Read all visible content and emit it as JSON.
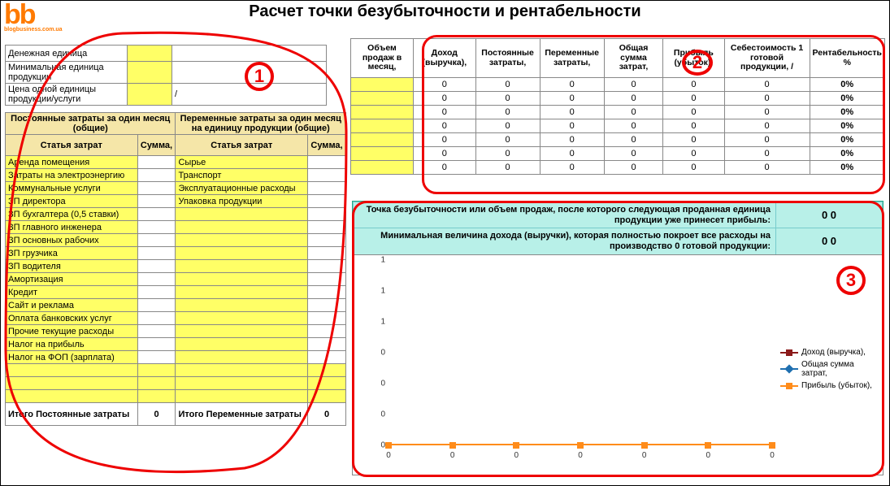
{
  "title": "Расчет точки безубыточности и рентабельности",
  "logo": {
    "bb": "bb",
    "sub": "blogbusiness.com.ua"
  },
  "params": [
    {
      "label": "Денежная единица",
      "unit": ""
    },
    {
      "label": "Минимальная единица продукции",
      "unit": ""
    },
    {
      "label": "Цена одной единицы продукции/услуги",
      "unit": "/"
    }
  ],
  "fixed_header": "Постоянные затраты за один месяц (общие)",
  "var_header": "Переменные затраты за один месяц на единицу продукции (общие)",
  "col_item": "Статья затрат",
  "col_sum": "Сумма,",
  "fixed_items": [
    "Аренда помещения",
    "Затраты на электроэнергию",
    "Коммунальные услуги",
    "ЗП директора",
    "ЗП бухгалтера (0,5 ставки)",
    "ЗП главного инженера",
    "ЗП основных рабочих",
    "ЗП грузчика",
    "ЗП водителя",
    "Амортизация",
    "Кредит",
    "Сайт и реклама",
    "Оплата банковских услуг",
    "Прочие текущие расходы",
    "Налог на прибыль",
    "Налог на ФОП (зарплата)"
  ],
  "var_items": [
    "Сырье",
    "Транспорт",
    "Эксплуатационные расходы",
    "Упаковка продукции"
  ],
  "fixed_total_label": "Итого Постоянные затраты",
  "var_total_label": "Итого Переменные затраты",
  "fixed_total": "0",
  "var_total": "0",
  "rtop_headers": [
    "Объем продаж в месяц,",
    "Доход (выручка),",
    "Постоянные затраты,",
    "Переменные затраты,",
    "Общая сумма затрат,",
    "Прибыль (убыток),",
    "Себестоимость 1 готовой продукции, /",
    "Рентабельность %"
  ],
  "rtop_rows": [
    [
      "",
      "0",
      "0",
      "0",
      "0",
      "0",
      "0",
      "0%"
    ],
    [
      "",
      "0",
      "0",
      "0",
      "0",
      "0",
      "0",
      "0%"
    ],
    [
      "",
      "0",
      "0",
      "0",
      "0",
      "0",
      "0",
      "0%"
    ],
    [
      "",
      "0",
      "0",
      "0",
      "0",
      "0",
      "0",
      "0%"
    ],
    [
      "",
      "0",
      "0",
      "0",
      "0",
      "0",
      "0",
      "0%"
    ],
    [
      "",
      "0",
      "0",
      "0",
      "0",
      "0",
      "0",
      "0%"
    ],
    [
      "",
      "0",
      "0",
      "0",
      "0",
      "0",
      "0",
      "0%"
    ]
  ],
  "summary": [
    {
      "txt": "Точка безубыточности или объем продаж, после которого следующая проданная единица продукции уже принесет прибыль:",
      "val": "0 0"
    },
    {
      "txt": "Минимальная величина дохода (выручки), которая полностью покроет все расходы на производство 0  готовой продукции:",
      "val": "0 0"
    }
  ],
  "chart_data": {
    "type": "line",
    "x": [
      0,
      0,
      0,
      0,
      0,
      0,
      0
    ],
    "series": [
      {
        "name": "Доход (выручка),",
        "values": [
          0,
          0,
          0,
          0,
          0,
          0,
          0
        ],
        "color": "#8b1a1a"
      },
      {
        "name": "Общая сумма затрат,",
        "values": [
          0,
          0,
          0,
          0,
          0,
          0,
          0
        ],
        "color": "#1f6fb0"
      },
      {
        "name": "Прибыль (убыток),",
        "values": [
          0,
          0,
          0,
          0,
          0,
          0,
          0
        ],
        "color": "#ff8c1a"
      }
    ],
    "yticks": [
      0,
      0,
      0,
      0,
      1,
      1,
      1
    ],
    "xticks": [
      0,
      0,
      0,
      0,
      0,
      0,
      0
    ],
    "legend_position": "right"
  },
  "annotations": {
    "a1": "1",
    "a2": "2",
    "a3": "3"
  }
}
